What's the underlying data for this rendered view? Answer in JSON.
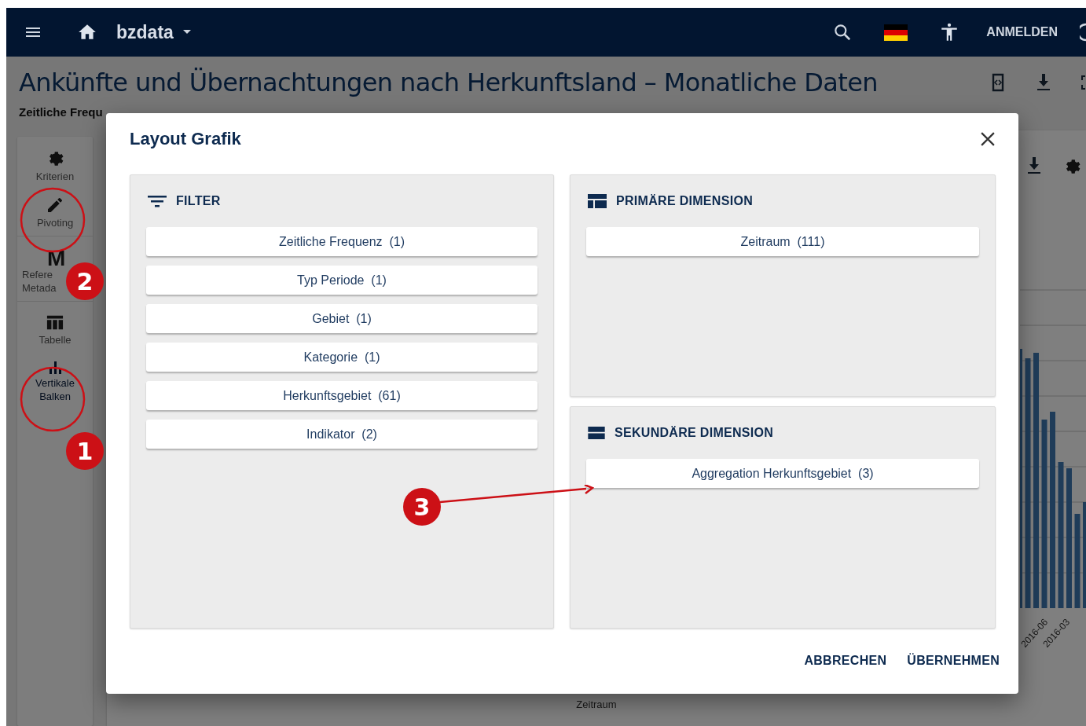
{
  "top_bar": {
    "app_name": "bzdata",
    "login": "ANMELDEN"
  },
  "page": {
    "title": "Ankünfte und Übernachtungen nach Herkunftsland – Monatliche Daten",
    "subtitle": "Zeitliche Frequ"
  },
  "sidebar": {
    "groups": [
      [
        {
          "lines": [
            "Kriterien"
          ],
          "selected": false
        },
        {
          "lines": [
            "Pivoting"
          ],
          "selected": false
        }
      ],
      [
        {
          "glyph": "M",
          "lines": [
            "Refere",
            "Metada"
          ],
          "selected": false
        }
      ],
      [
        {
          "lines": [
            "Tabelle"
          ],
          "selected": false
        },
        {
          "lines": [
            "Vertikale",
            "Balken"
          ],
          "selected": true
        }
      ]
    ]
  },
  "chart": {
    "x_labels": [
      "2016-06",
      "2016-03"
    ],
    "x_axis_title": "Zeitraum"
  },
  "dialog": {
    "title": "Layout Grafik",
    "panels": [
      {
        "kind": "filter",
        "title": "FILTER",
        "chips": [
          "Zeitliche Frequenz  (1)",
          "Typ Periode  (1)",
          "Gebiet  (1)",
          "Kategorie  (1)",
          "Herkunftsgebiet  (61)",
          "Indikator  (2)"
        ]
      },
      {
        "kind": "primary",
        "title": "PRIMÄRE DIMENSION",
        "chips": [
          "Zeitraum  (111)"
        ]
      },
      {
        "kind": "secondary",
        "title": "SEKUNDÄRE DIMENSION",
        "chips": [
          "Aggregation Herkunftsgebiet  (3)"
        ]
      }
    ],
    "buttons": [
      "ABBRECHEN",
      "ÜBERNEHMEN"
    ]
  },
  "annotations": {
    "badges": [
      "1",
      "2",
      "3"
    ]
  }
}
